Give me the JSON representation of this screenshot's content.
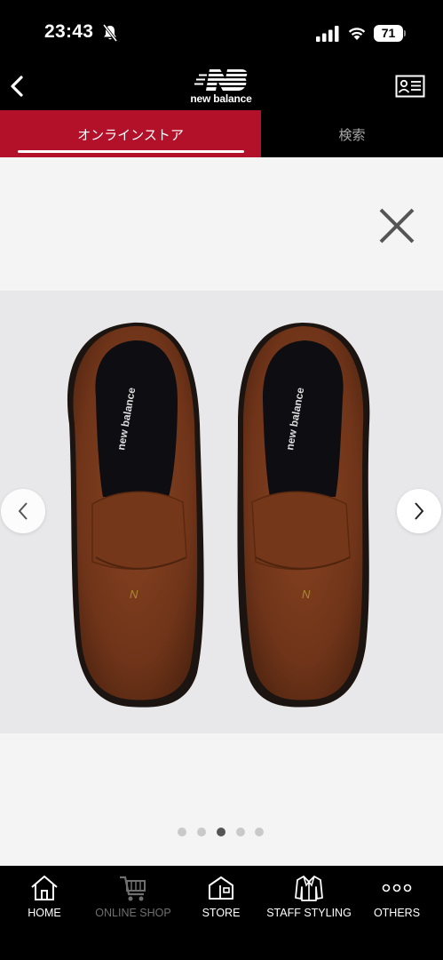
{
  "status_bar": {
    "time": "23:43",
    "battery": "71",
    "icons": [
      "bell-slash-icon",
      "signal-icon",
      "wifi-icon",
      "battery-icon"
    ]
  },
  "header": {
    "logo_text": "new balance",
    "icons": [
      "back-chevron-icon",
      "nb-logo",
      "member-card-icon"
    ]
  },
  "tabs": [
    {
      "label": "オンラインストア",
      "active": true
    },
    {
      "label": "検索",
      "active": false
    }
  ],
  "viewer": {
    "icons": [
      "close-icon",
      "chevron-left-icon",
      "chevron-right-icon"
    ],
    "slide_count": 5,
    "active_slide": 3,
    "brand_color": "#b3102a"
  },
  "bottom_nav": [
    {
      "label": "HOME",
      "icon": "home-icon",
      "enabled": true
    },
    {
      "label": "ONLINE SHOP",
      "icon": "cart-icon",
      "enabled": false
    },
    {
      "label": "STORE",
      "icon": "store-icon",
      "enabled": true
    },
    {
      "label": "STAFF STYLING",
      "icon": "jacket-icon",
      "enabled": true
    },
    {
      "label": "OTHERS",
      "icon": "more-dots-icon",
      "enabled": true
    }
  ]
}
